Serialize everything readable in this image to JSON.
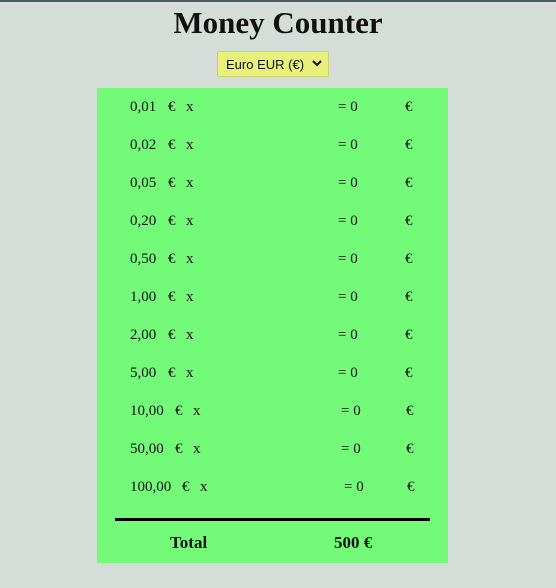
{
  "page": {
    "title": "Money Counter"
  },
  "currency_select": {
    "selected": "Euro EUR (€)"
  },
  "rows": [
    {
      "denomination": "0,01",
      "currency": "€",
      "multiplier": "x",
      "result": "= 0",
      "unit": "€"
    },
    {
      "denomination": "0,02",
      "currency": "€",
      "multiplier": "x",
      "result": "= 0",
      "unit": "€"
    },
    {
      "denomination": "0,05",
      "currency": "€",
      "multiplier": "x",
      "result": "= 0",
      "unit": "€"
    },
    {
      "denomination": "0,20",
      "currency": "€",
      "multiplier": "x",
      "result": "= 0",
      "unit": "€"
    },
    {
      "denomination": "0,50",
      "currency": "€",
      "multiplier": "x",
      "result": "= 0",
      "unit": "€"
    },
    {
      "denomination": "1,00",
      "currency": "€",
      "multiplier": "x",
      "result": "= 0",
      "unit": "€"
    },
    {
      "denomination": "2,00",
      "currency": "€",
      "multiplier": "x",
      "result": "= 0",
      "unit": "€"
    },
    {
      "denomination": "5,00",
      "currency": "€",
      "multiplier": "x",
      "result": "= 0",
      "unit": "€"
    },
    {
      "denomination": "10,00",
      "currency": "€",
      "multiplier": "x",
      "result": "= 0",
      "unit": "€"
    },
    {
      "denomination": "50,00",
      "currency": "€",
      "multiplier": "x",
      "result": "= 0",
      "unit": "€"
    },
    {
      "denomination": "100,00",
      "currency": "€",
      "multiplier": "x",
      "result": "= 0",
      "unit": "€"
    }
  ],
  "total": {
    "label": "Total",
    "value": "500 €"
  },
  "colors": {
    "background": "#d5ddd8",
    "panel": "#73fa78",
    "select": "#e6f07a"
  },
  "icons": {
    "select_arrow": "chevron-down-icon"
  }
}
